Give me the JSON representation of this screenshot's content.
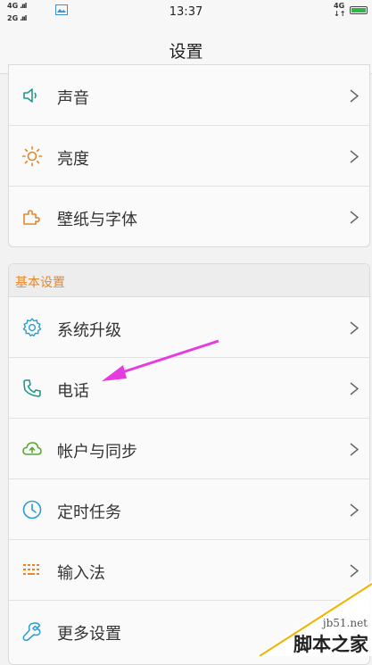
{
  "status_bar": {
    "signal_1": "4G",
    "signal_2": "2G",
    "bars": ".ııl",
    "time": "13:37",
    "network": "4G"
  },
  "header": {
    "title": "设置"
  },
  "group_1": {
    "items": [
      {
        "label": "声音",
        "icon": "speaker-icon"
      },
      {
        "label": "亮度",
        "icon": "sun-icon"
      },
      {
        "label": "壁纸与字体",
        "icon": "puzzle-icon"
      }
    ]
  },
  "group_2": {
    "title": "基本设置",
    "items": [
      {
        "label": "系统升级",
        "icon": "gear-icon"
      },
      {
        "label": "电话",
        "icon": "phone-icon"
      },
      {
        "label": "帐户与同步",
        "icon": "cloud-sync-icon"
      },
      {
        "label": "定时任务",
        "icon": "clock-icon"
      },
      {
        "label": "输入法",
        "icon": "keyboard-icon"
      },
      {
        "label": "更多设置",
        "icon": "wrench-icon"
      }
    ]
  },
  "watermark": {
    "site": "jb51.net",
    "site_cn": "脚本之家"
  },
  "colors": {
    "accent_orange": "#e3872d",
    "accent_teal": "#1e9a8c",
    "annotation_arrow": "#e53be0"
  }
}
